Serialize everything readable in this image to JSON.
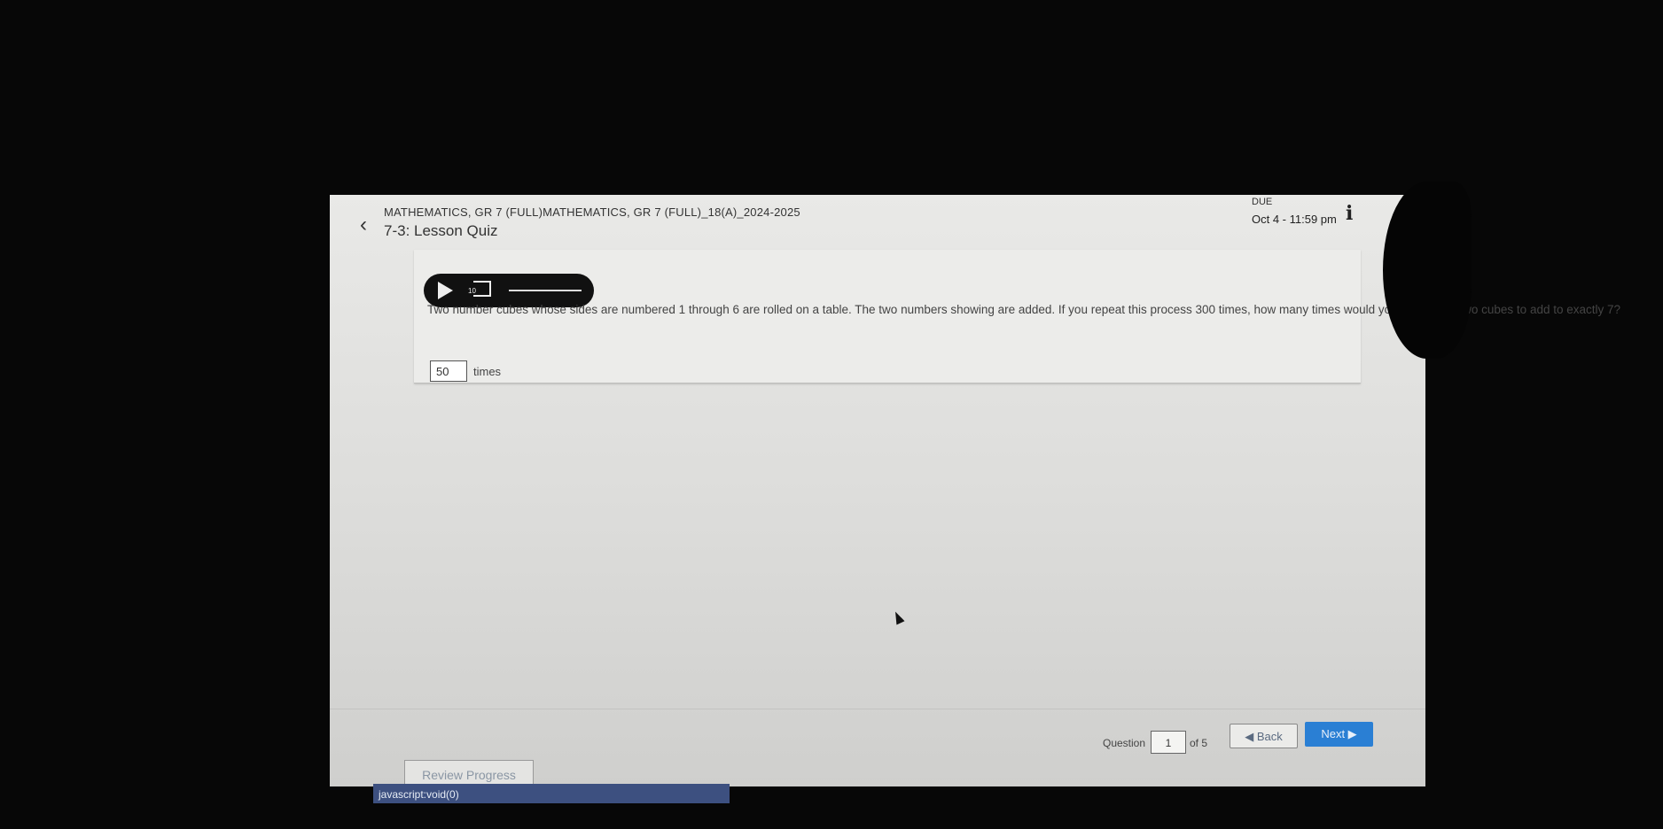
{
  "header": {
    "course": "MATHEMATICS, GR 7 (FULL)MATHEMATICS, GR 7 (FULL)_18(A)_2024-2025",
    "quiz_title": "7-3: Lesson Quiz",
    "due_label": "DUE",
    "due_date": "Oct 4 - 11:59 pm",
    "back_icon": "chevron-left-icon",
    "info_icon": "info-icon",
    "info_glyph": "i"
  },
  "player": {
    "play_icon": "play-icon",
    "rewind_icon": "rewind-10-icon",
    "rewind_label": "10"
  },
  "question": {
    "text": "Two number cubes whose sides are numbered 1 through 6 are rolled on a table. The two numbers showing are added. If you repeat this process 300 times, how many times would you expect the two cubes to add to exactly 7?",
    "answer_value": "50",
    "answer_unit": "times"
  },
  "footer": {
    "question_label": "Question",
    "question_number": "1",
    "of_total": "of 5",
    "back_label": "◀ Back",
    "next_label": "Next ▶",
    "review_label": "Review Progress",
    "next_color": "#2a7fd4"
  },
  "status_bar": {
    "text": "javascript:void(0)"
  }
}
